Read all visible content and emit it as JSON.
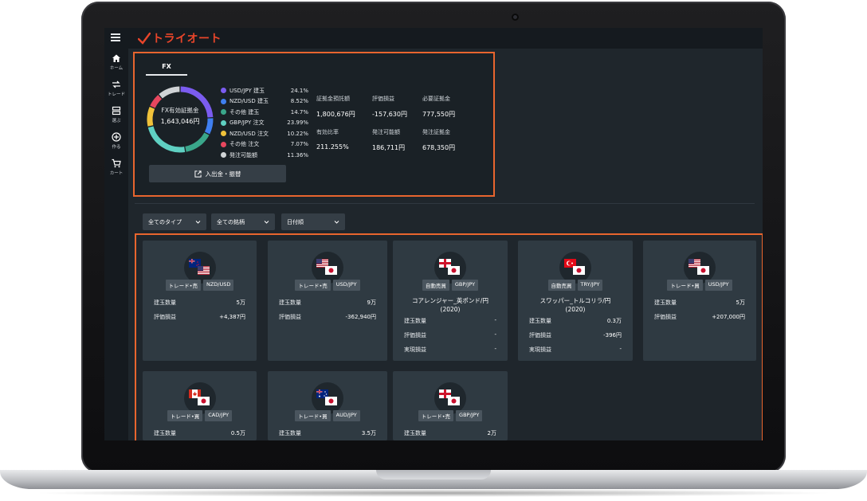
{
  "app": {
    "logo_text": "トライオート"
  },
  "sidebar": {
    "items": [
      {
        "label": "ホーム",
        "icon": "home-icon"
      },
      {
        "label": "トレード",
        "icon": "trade-arrows-icon"
      },
      {
        "label": "選ぶ",
        "icon": "select-list-icon"
      },
      {
        "label": "作る",
        "icon": "plus-circle-icon"
      },
      {
        "label": "カート",
        "icon": "cart-icon"
      }
    ]
  },
  "fx_summary": {
    "tab_label": "FX",
    "donut_label": "FX有効証拠金",
    "donut_value": "1,643,046円",
    "legend": [
      {
        "name": "USD/JPY 建玉",
        "pct": "24.1%",
        "value": 24.1,
        "color": "#7b5cf0"
      },
      {
        "name": "NZD/USD 建玉",
        "pct": "8.52%",
        "value": 8.52,
        "color": "#3f7ff0"
      },
      {
        "name": "その他 建玉",
        "pct": "14.7%",
        "value": 14.7,
        "color": "#3aa78b"
      },
      {
        "name": "GBP/JPY 注文",
        "pct": "23.99%",
        "value": 23.99,
        "color": "#5fd0c2"
      },
      {
        "name": "NZD/USD 注文",
        "pct": "10.22%",
        "value": 10.22,
        "color": "#f0c23a"
      },
      {
        "name": "その他 注文",
        "pct": "7.07%",
        "value": 7.07,
        "color": "#e8475e"
      },
      {
        "name": "発注可能額",
        "pct": "11.36%",
        "value": 11.36,
        "color": "#d0d3d6"
      }
    ],
    "stats": [
      {
        "label": "証拠金預託額",
        "value": "1,800,676円"
      },
      {
        "label": "評価損益",
        "value": "-157,630円"
      },
      {
        "label": "必要証拠金",
        "value": "777,550円"
      },
      {
        "label": "有効比率",
        "value": "211.255%"
      },
      {
        "label": "発注可能額",
        "value": "186,711円"
      },
      {
        "label": "発注証拠金",
        "value": "678,350円"
      }
    ],
    "deposit_button": "入出金・振替"
  },
  "filters": [
    {
      "label": "全てのタイプ"
    },
    {
      "label": "全ての銘柄"
    },
    {
      "label": "日付順"
    }
  ],
  "cards": [
    {
      "flags": [
        "nz",
        "us"
      ],
      "tags": [
        "トレード•売",
        "NZD/USD"
      ],
      "title": "",
      "rows": [
        {
          "k": "建玉数量",
          "v": "5万"
        },
        {
          "k": "評価損益",
          "v": "+4,387円"
        }
      ]
    },
    {
      "flags": [
        "us",
        "jp"
      ],
      "tags": [
        "トレード•売",
        "USD/JPY"
      ],
      "title": "",
      "rows": [
        {
          "k": "建玉数量",
          "v": "9万"
        },
        {
          "k": "評価損益",
          "v": "-362,940円"
        }
      ]
    },
    {
      "flags": [
        "gb",
        "jp"
      ],
      "tags": [
        "自動売買",
        "GBP/JPY"
      ],
      "title": "コアレンジャー_英ポンド/円\n(2020)",
      "rows": [
        {
          "k": "建玉数量",
          "v": "-"
        },
        {
          "k": "評価損益",
          "v": "-"
        },
        {
          "k": "実現損益",
          "v": "-"
        }
      ]
    },
    {
      "flags": [
        "tr",
        "jp"
      ],
      "tags": [
        "自動売買",
        "TRY/JPY"
      ],
      "title": "スワッパー_トルコリラ/円\n(2020)",
      "rows": [
        {
          "k": "建玉数量",
          "v": "0.3万"
        },
        {
          "k": "評価損益",
          "v": "-396円"
        },
        {
          "k": "実現損益",
          "v": "-"
        }
      ]
    },
    {
      "flags": [
        "us",
        "jp"
      ],
      "tags": [
        "トレード•買",
        "USD/JPY"
      ],
      "title": "",
      "rows": [
        {
          "k": "建玉数量",
          "v": "5万"
        },
        {
          "k": "評価損益",
          "v": "+207,000円"
        }
      ]
    },
    {
      "flags": [
        "ca",
        "jp"
      ],
      "tags": [
        "トレード•買",
        "CAD/JPY"
      ],
      "title": "",
      "rows": [
        {
          "k": "建玉数量",
          "v": "0.5万"
        }
      ]
    },
    {
      "flags": [
        "au",
        "jp"
      ],
      "tags": [
        "トレード•買",
        "AUD/JPY"
      ],
      "title": "",
      "rows": [
        {
          "k": "建玉数量",
          "v": "3.5万"
        }
      ]
    },
    {
      "flags": [
        "gb",
        "jp"
      ],
      "tags": [
        "トレード•売",
        "GBP/JPY"
      ],
      "title": "",
      "rows": [
        {
          "k": "建玉数量",
          "v": "2万"
        }
      ]
    }
  ],
  "colors": {
    "accent": "#e8452a",
    "highlight_outline": "#e8652e",
    "card_bg": "#2f3a42",
    "screen_bg": "#1f262c"
  }
}
